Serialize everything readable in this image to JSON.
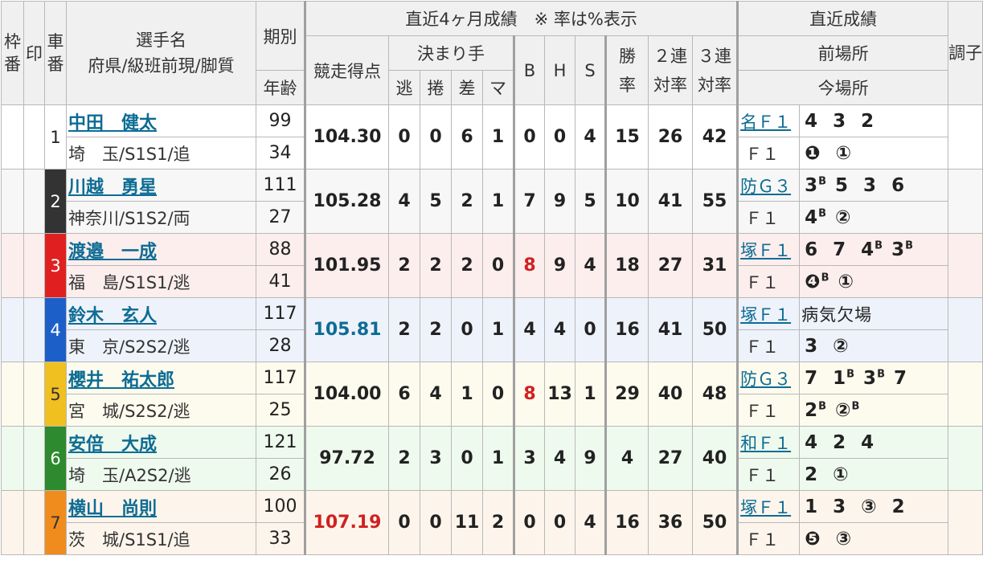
{
  "header": {
    "waku": "枠番",
    "shirushi": "印",
    "sha": "車番",
    "name_title": "選手名",
    "name_sub": "府県/級班前現/脚質",
    "kibetsu": "期別",
    "nenrei": "年齢",
    "recent4": "直近4ヶ月成績　※ 率は%表示",
    "score": "競走得点",
    "kimarite": "決まり手",
    "nige": "逃",
    "makuri": "捲",
    "sashi": "差",
    "ma": "マ",
    "b": "B",
    "h": "H",
    "s": "S",
    "shoritsu": "勝率",
    "niren": "２連対率",
    "sanren": "３連対率",
    "recent_results": "直近成績",
    "prev_venue": "前場所",
    "curr_venue": "今場所",
    "choushi": "調子"
  },
  "rows": [
    {
      "car": "1",
      "color": "#ffffff",
      "text_color": "#222222",
      "bg": "#ffffff",
      "name": "中田　健太",
      "info": "埼　玉/S1S1/追",
      "kibetsu": "99",
      "age": "34",
      "score": "104.30",
      "score_color": "#222222",
      "nige": "0",
      "makuri": "0",
      "sashi": "6",
      "ma": "1",
      "b": "0",
      "b_color": "#222222",
      "h": "0",
      "s": "4",
      "win": "15",
      "quinella": "26",
      "trio": "42",
      "prev_label": "名Ｆ１",
      "prev_results": [
        "4",
        "3",
        "2"
      ],
      "curr_label": "Ｆ１",
      "curr_results": [
        "❶",
        "①"
      ]
    },
    {
      "car": "2",
      "color": "#333333",
      "text_color": "#ffffff",
      "bg": "#f7f7f7",
      "name": "川越　勇星",
      "info": "神奈川/S1S2/両",
      "kibetsu": "111",
      "age": "27",
      "score": "105.28",
      "score_color": "#222222",
      "nige": "4",
      "makuri": "5",
      "sashi": "2",
      "ma": "1",
      "b": "7",
      "b_color": "#222222",
      "h": "9",
      "s": "5",
      "win": "10",
      "quinella": "41",
      "trio": "55",
      "prev_label": "防Ｇ３",
      "prev_results": [
        "3^B",
        "5",
        "3",
        "6"
      ],
      "curr_label": "Ｆ１",
      "curr_results": [
        "4^B",
        "②"
      ]
    },
    {
      "car": "3",
      "color": "#e02020",
      "text_color": "#ffffff",
      "bg": "#fdeeee",
      "name": "渡邉　一成",
      "info": "福　島/S1S1/逃",
      "kibetsu": "88",
      "age": "41",
      "score": "101.95",
      "score_color": "#222222",
      "nige": "2",
      "makuri": "2",
      "sashi": "2",
      "ma": "0",
      "b": "8",
      "b_color": "#d12020",
      "h": "9",
      "s": "4",
      "win": "18",
      "quinella": "27",
      "trio": "31",
      "prev_label": "塚Ｆ１",
      "prev_results": [
        "6",
        "7",
        "4^B",
        "3^B"
      ],
      "curr_label": "Ｆ１",
      "curr_results": [
        "❹^B",
        "①"
      ]
    },
    {
      "car": "4",
      "color": "#1d5fc8",
      "text_color": "#ffffff",
      "bg": "#eef2fb",
      "name": "鈴木　玄人",
      "info": "東　京/S2S2/逃",
      "kibetsu": "117",
      "age": "28",
      "score": "105.81",
      "score_color": "#0d6c94",
      "nige": "2",
      "makuri": "2",
      "sashi": "0",
      "ma": "1",
      "b": "4",
      "b_color": "#222222",
      "h": "4",
      "s": "0",
      "win": "16",
      "quinella": "41",
      "trio": "50",
      "prev_label": "塚Ｆ１",
      "prev_text": "病気欠場",
      "prev_results": [],
      "curr_label": "Ｆ１",
      "curr_results": [
        "3",
        "②"
      ]
    },
    {
      "car": "5",
      "color": "#f0c020",
      "text_color": "#333333",
      "bg": "#fdfbee",
      "name": "櫻井　祐太郎",
      "info": "宮　城/S2S2/逃",
      "kibetsu": "117",
      "age": "25",
      "score": "104.00",
      "score_color": "#222222",
      "nige": "6",
      "makuri": "4",
      "sashi": "1",
      "ma": "0",
      "b": "8",
      "b_color": "#d12020",
      "h": "13",
      "s": "1",
      "win": "29",
      "quinella": "40",
      "trio": "48",
      "prev_label": "防Ｇ３",
      "prev_results": [
        "7",
        "1^B",
        "3^B",
        "7"
      ],
      "curr_label": "Ｆ１",
      "curr_results": [
        "2^B",
        "②^B"
      ]
    },
    {
      "car": "6",
      "color": "#2e8a2e",
      "text_color": "#ffffff",
      "bg": "#eefaee",
      "name": "安倍　大成",
      "info": "埼　玉/A2S2/逃",
      "kibetsu": "121",
      "age": "26",
      "score": "97.72",
      "score_color": "#222222",
      "nige": "2",
      "makuri": "3",
      "sashi": "0",
      "ma": "1",
      "b": "3",
      "b_color": "#222222",
      "h": "4",
      "s": "9",
      "win": "4",
      "quinella": "27",
      "trio": "40",
      "prev_label": "和Ｆ１",
      "prev_results": [
        "4",
        "2",
        "4"
      ],
      "curr_label": "Ｆ１",
      "curr_results": [
        "2",
        "①"
      ]
    },
    {
      "car": "7",
      "color": "#f08c1e",
      "text_color": "#333333",
      "bg": "#fdf5ec",
      "name": "横山　尚則",
      "info": "茨　城/S1S1/追",
      "kibetsu": "100",
      "age": "33",
      "score": "107.19",
      "score_color": "#d12020",
      "nige": "0",
      "makuri": "0",
      "sashi": "11",
      "ma": "2",
      "b": "0",
      "b_color": "#222222",
      "h": "0",
      "s": "4",
      "win": "16",
      "quinella": "36",
      "trio": "50",
      "prev_label": "塚Ｆ１",
      "prev_results": [
        "1",
        "3",
        "③",
        "2"
      ],
      "curr_label": "Ｆ１",
      "curr_results": [
        "❺",
        "③"
      ]
    }
  ]
}
